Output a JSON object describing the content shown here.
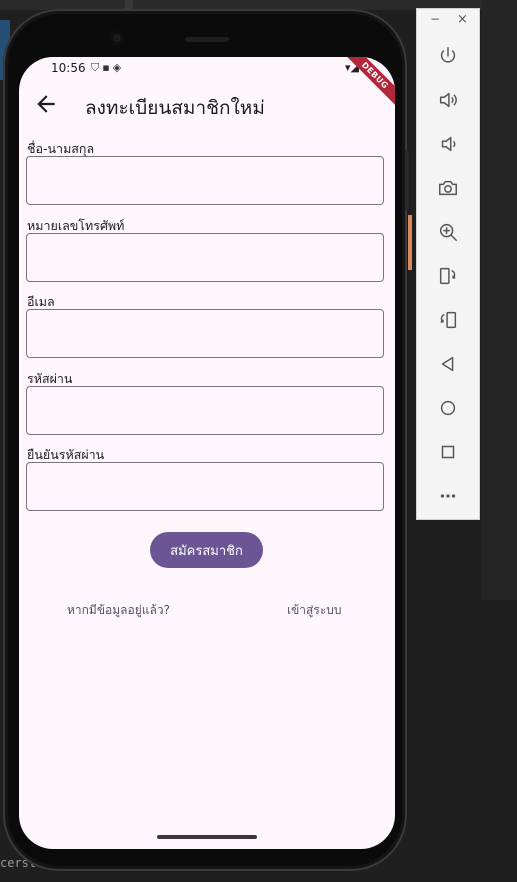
{
  "status": {
    "time": "10:56",
    "debug_banner": "DEBUG"
  },
  "appbar": {
    "title": "ลงทะเบียนสมาชิกใหม่"
  },
  "form": {
    "fields": [
      {
        "label": "ชื่อ-นามสกุล",
        "value": ""
      },
      {
        "label": "หมายเลขโทรศัพท์",
        "value": ""
      },
      {
        "label": "อีเมล",
        "value": ""
      },
      {
        "label": "รหัสผ่าน",
        "value": ""
      },
      {
        "label": "ยืนยันรหัสผ่าน",
        "value": ""
      }
    ],
    "submit_label": "สมัครสมาชิก",
    "have_account_text": "หากมีข้อมูลอยู่แล้ว?",
    "login_label": "เข้าสู่ระบบ"
  },
  "desktop": {
    "bottom_text": "cerst"
  },
  "emulator": {
    "minimize": "−",
    "close": "×",
    "buttons": [
      "power-icon",
      "volume-up-icon",
      "volume-down-icon",
      "camera-icon",
      "zoom-in-icon",
      "rotate-left-icon",
      "rotate-right-icon",
      "back-icon",
      "home-icon",
      "overview-icon",
      "more-icon"
    ]
  },
  "colors": {
    "accent": "#6c5594",
    "screen_bg": "#fdf7fd"
  }
}
